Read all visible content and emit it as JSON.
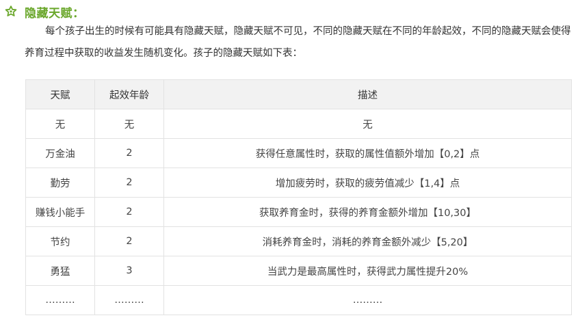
{
  "section": {
    "icon": "flower-outline-icon",
    "title": "隐藏天赋："
  },
  "intro": {
    "text": "每个孩子出生的时候有可能具有隐藏天赋，隐藏天赋不可见，不同的隐藏天赋在不同的年龄起效，不同的隐藏天赋会使得养育过程中获取的收益发生随机变化。孩子的隐藏天赋如下表："
  },
  "table": {
    "headers": [
      "天赋",
      "起效年龄",
      "描述"
    ],
    "rows": [
      {
        "talent": "无",
        "age": "无",
        "desc": "无"
      },
      {
        "talent": "万金油",
        "age": "2",
        "desc": "获得任意属性时，获取的属性值额外增加【0,2】点"
      },
      {
        "talent": "勤劳",
        "age": "2",
        "desc": "增加疲劳时，获取的疲劳值减少【1,4】点"
      },
      {
        "talent": "赚钱小能手",
        "age": "2",
        "desc": "获取养育金时，获得的养育金额外增加【10,30】"
      },
      {
        "talent": "节约",
        "age": "2",
        "desc": "消耗养育金时，消耗的养育金额外减少【5,20】"
      },
      {
        "talent": "勇猛",
        "age": "3",
        "desc": "当武力是最高属性时，获得武力属性提升20%"
      },
      {
        "talent": "………",
        "age": "………",
        "desc": "………"
      }
    ]
  },
  "colors": {
    "accent": "#6aa72b",
    "header_bg": "#f2f2f2",
    "border": "#e2e2e2"
  }
}
